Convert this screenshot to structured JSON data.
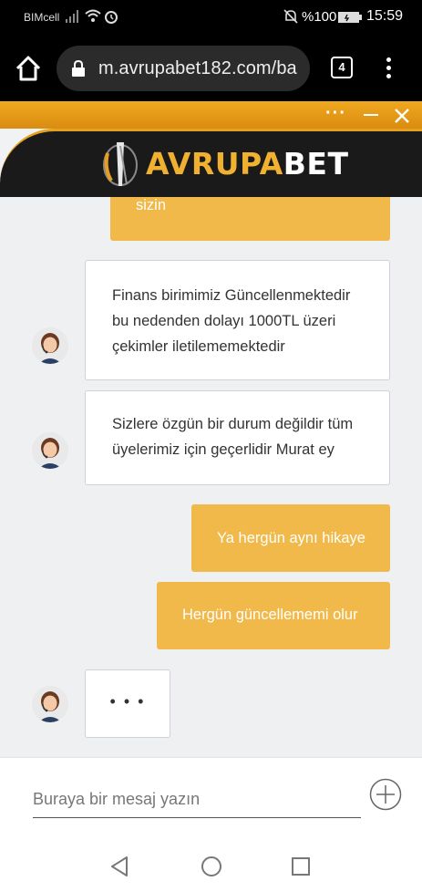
{
  "status_bar": {
    "carrier": "BIMcell",
    "battery": "%100",
    "time": "15:59"
  },
  "browser": {
    "url": "m.avrupabet182.com/ba",
    "tab_count": "4"
  },
  "brand": {
    "name_part1": "AVRUPA",
    "name_part2": "BET",
    "accent": "#f0b94a"
  },
  "messages": [
    {
      "from": "user",
      "text": "sizin"
    },
    {
      "from": "agent",
      "lines": [
        "Finans birimimiz Güncellenmektedir",
        "bu nedenden dolayı 1000TL üzeri",
        "çekimler iletilememektedir"
      ]
    },
    {
      "from": "agent",
      "lines": [
        "Sizlere özgün bir durum değildir tüm",
        "üyelerimiz için geçerlidir Murat ey"
      ]
    },
    {
      "from": "user",
      "text": "Ya hergün aynı hikaye"
    },
    {
      "from": "user",
      "text": "Hergün güncellememi olur"
    },
    {
      "from": "agent",
      "typing": "• • •"
    }
  ],
  "composer": {
    "placeholder": "Buraya bir mesaj yazın",
    "value": ""
  }
}
